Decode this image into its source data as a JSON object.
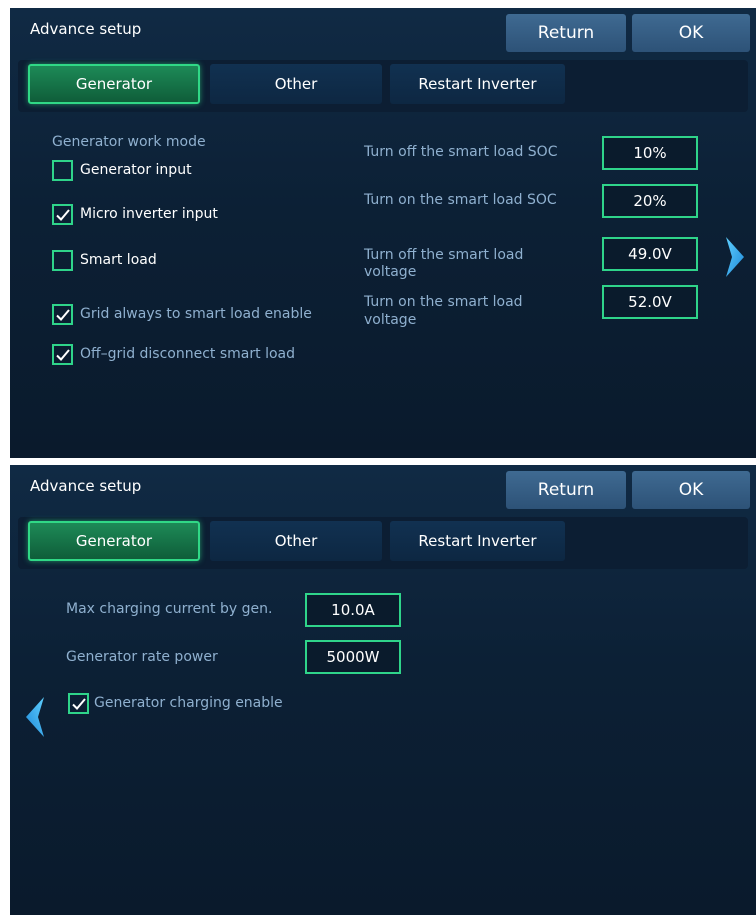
{
  "colors": {
    "accent": "#2fd48a",
    "panel": "#0c2035",
    "button": "#2d5277",
    "muted_text": "#8fb0cf"
  },
  "screens": [
    {
      "title": "Advance setup",
      "buttons": {
        "return": "Return",
        "ok": "OK"
      },
      "tabs": [
        {
          "label": "Generator",
          "active": true
        },
        {
          "label": "Other",
          "active": false
        },
        {
          "label": "Restart Inverter",
          "active": false
        }
      ],
      "section_title": "Generator work mode",
      "checkboxes": [
        {
          "label": "Generator input",
          "checked": false
        },
        {
          "label": "Micro inverter input",
          "checked": true
        },
        {
          "label": "Smart load",
          "checked": false
        },
        {
          "label": "Grid always to smart load enable",
          "checked": true
        },
        {
          "label": "Off–grid disconnect smart load",
          "checked": true
        }
      ],
      "settings": [
        {
          "label": "Turn off the smart load SOC",
          "value": "10%"
        },
        {
          "label": "Turn on the smart load SOC",
          "value": "20%"
        },
        {
          "label_line1": "Turn off the smart load",
          "label_line2": "voltage",
          "value": "49.0V"
        },
        {
          "label_line1": "Turn on the smart load",
          "label_line2": "voltage",
          "value": "52.0V"
        }
      ],
      "nav_icon": "chevron-right-icon"
    },
    {
      "title": "Advance setup",
      "buttons": {
        "return": "Return",
        "ok": "OK"
      },
      "tabs": [
        {
          "label": "Generator",
          "active": true
        },
        {
          "label": "Other",
          "active": false
        },
        {
          "label": "Restart Inverter",
          "active": false
        }
      ],
      "settings": [
        {
          "label": "Max charging current by gen.",
          "value": "10.0A"
        },
        {
          "label": "Generator rate power",
          "value": "5000W"
        }
      ],
      "checkboxes": [
        {
          "label": "Generator charging enable",
          "checked": true
        }
      ],
      "nav_icon": "chevron-left-icon"
    }
  ]
}
